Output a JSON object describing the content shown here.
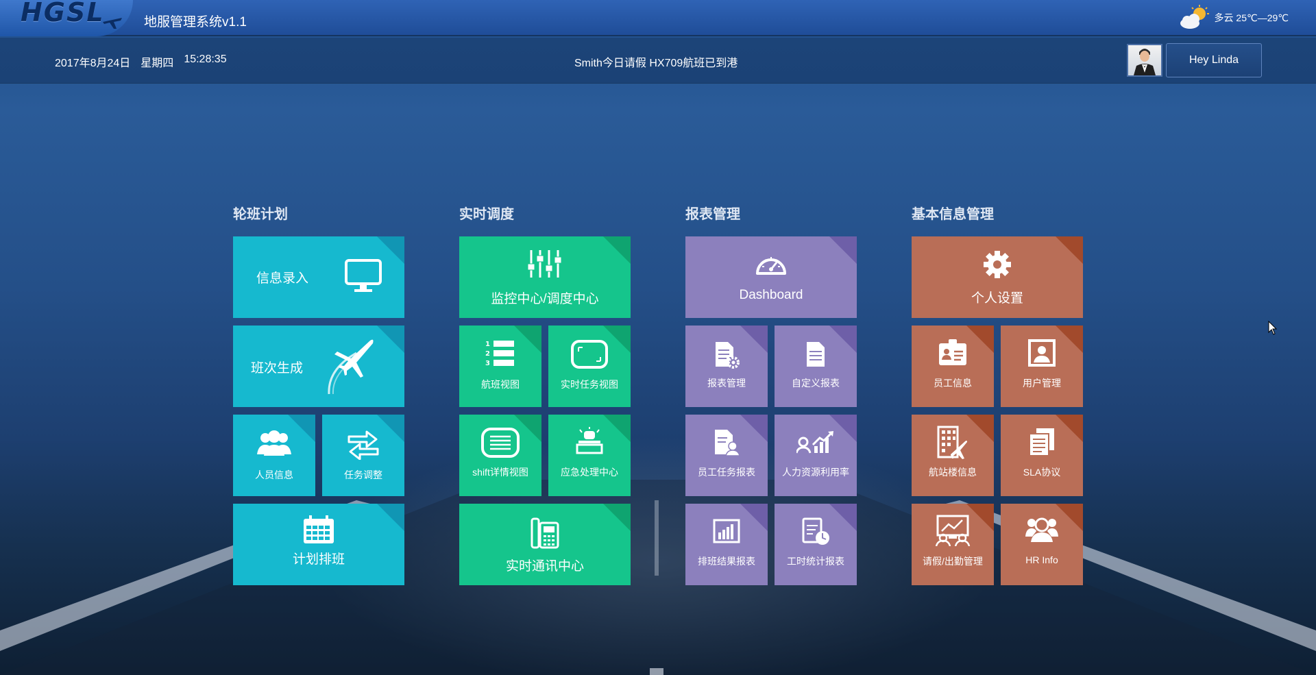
{
  "header": {
    "logo_text": "HGSL",
    "app_title": "地服管理系统v1.1",
    "weather": {
      "icon": "partly-cloudy-icon",
      "text": "多云 25℃—29℃"
    }
  },
  "infobar": {
    "date": "2017年8月24日",
    "weekday": "星期四",
    "time": "15:28:35",
    "notice": "Smith今日请假 HX709航班已到港",
    "user_greeting": "Hey Linda"
  },
  "colors": {
    "cyan": "#16b9cf",
    "green": "#15c58c",
    "purple": "#8c80bd",
    "orange": "#b96e57"
  },
  "groups": [
    {
      "title": "轮班计划",
      "tiles": [
        {
          "label": "信息录入",
          "icon": "monitor-icon"
        },
        {
          "label": "班次生成",
          "icon": "airplane-icon"
        },
        {
          "label": "人员信息",
          "icon": "users-icon"
        },
        {
          "label": "任务调整",
          "icon": "swap-arrows-icon"
        },
        {
          "label": "计划排班",
          "icon": "calendar-icon"
        }
      ]
    },
    {
      "title": "实时调度",
      "tiles": [
        {
          "label": "监控中心/调度中心",
          "icon": "sliders-icon"
        },
        {
          "label": "航班视图",
          "icon": "numbered-list-icon"
        },
        {
          "label": "实时任务视图",
          "icon": "screen-icon"
        },
        {
          "label": "shift详情视图",
          "icon": "details-screen-icon"
        },
        {
          "label": "应急处理中心",
          "icon": "alarm-icon"
        },
        {
          "label": "实时通讯中心",
          "icon": "phone-icon"
        }
      ]
    },
    {
      "title": "报表管理",
      "tiles": [
        {
          "label": "Dashboard",
          "icon": "gauge-icon"
        },
        {
          "label": "报表管理",
          "icon": "report-settings-icon"
        },
        {
          "label": "自定义报表",
          "icon": "document-icon"
        },
        {
          "label": "员工任务报表",
          "icon": "employee-report-icon"
        },
        {
          "label": "人力资源利用率",
          "icon": "hr-chart-icon"
        },
        {
          "label": "排班结果报表",
          "icon": "bar-chart-icon"
        },
        {
          "label": "工时统计报表",
          "icon": "timesheet-icon"
        }
      ]
    },
    {
      "title": "基本信息管理",
      "tiles": [
        {
          "label": "个人设置",
          "icon": "gear-icon"
        },
        {
          "label": "员工信息",
          "icon": "id-card-icon"
        },
        {
          "label": "用户管理",
          "icon": "user-portrait-icon"
        },
        {
          "label": "航站楼信息",
          "icon": "terminal-building-icon"
        },
        {
          "label": "SLA协议",
          "icon": "documents-icon"
        },
        {
          "label": "请假/出勤管理",
          "icon": "attendance-icon"
        },
        {
          "label": "HR Info",
          "icon": "hr-people-icon"
        }
      ]
    }
  ]
}
